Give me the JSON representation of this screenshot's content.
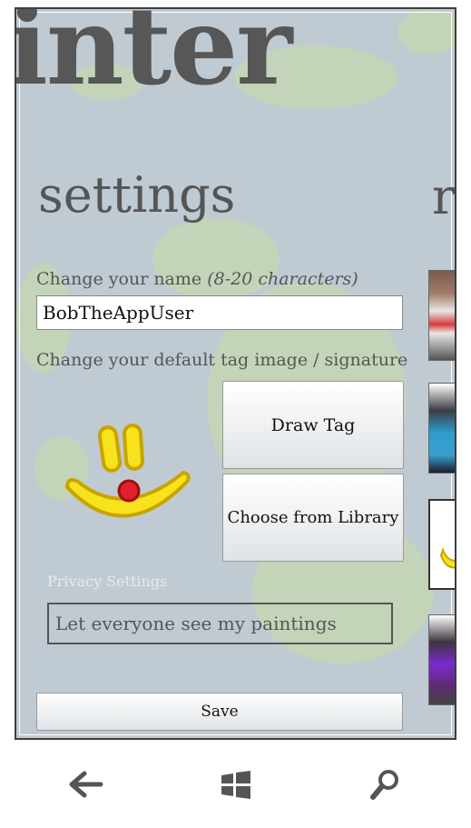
{
  "app": {
    "title": "inter"
  },
  "page": {
    "title": "settings",
    "next_peek": "r"
  },
  "name_section": {
    "label": "Change your name",
    "hint": "(8-20 characters)",
    "value": "BobTheAppUser"
  },
  "tag_section": {
    "label": "Change your default tag image / signature",
    "draw_label": "Draw Tag",
    "library_label": "Choose from Library"
  },
  "privacy": {
    "heading": "Privacy Settings",
    "toggle_label": "Let everyone see my paintings"
  },
  "actions": {
    "save_label": "Save"
  },
  "navbar": {
    "back": "back-arrow-icon",
    "start": "windows-logo-icon",
    "search": "search-icon"
  }
}
